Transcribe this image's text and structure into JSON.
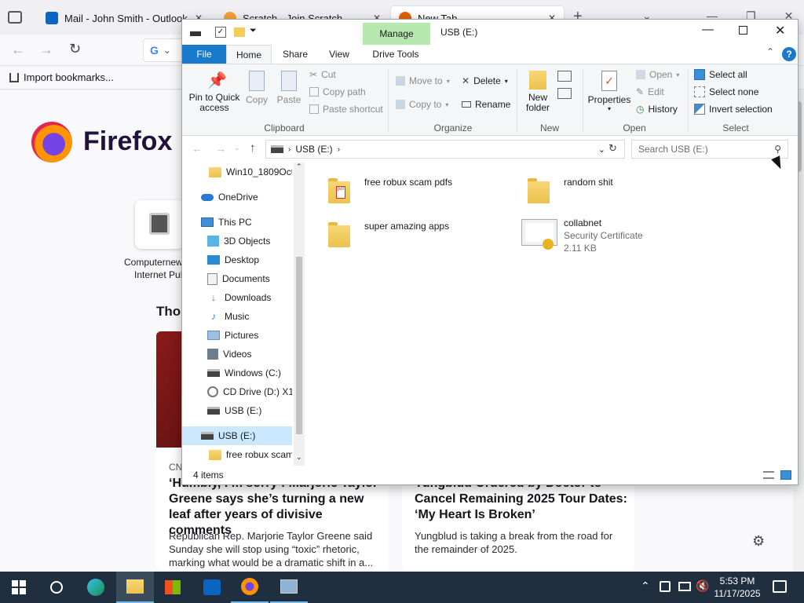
{
  "firefox": {
    "tabs": [
      {
        "title": "Mail - John Smith - Outlook"
      },
      {
        "title": "Scratch - Join Scratch"
      },
      {
        "title": "New Tab"
      }
    ],
    "bookmarks_import": "Import bookmarks...",
    "brand": "Firefox",
    "shortcut_label_1": "Computernew",
    "shortcut_label_2": "Internet Pul",
    "section_heading": "Thou",
    "story_left": {
      "source": "CN",
      "title": "‘Humbly, I’m sorry’: Marjorie Taylor Greene says she’s turning a new leaf after years of divisive comments",
      "excerpt": "Republican Rep. Marjorie Taylor Greene said Sunday she will stop using “toxic” rhetoric, marking what would be a dramatic shift in a..."
    },
    "story_right": {
      "title": "Yungblud Ordered by Doctor to Cancel Remaining 2025 Tour Dates: ‘My Heart Is Broken’",
      "excerpt": "Yungblud is taking a break from the road for the remainder of 2025."
    }
  },
  "explorer": {
    "title": "USB (E:)",
    "manage_tab": "Manage",
    "tabs": [
      "File",
      "Home",
      "Share",
      "View",
      "Drive Tools"
    ],
    "ribbon": {
      "clipboard": {
        "pin": "Pin to Quick access",
        "copy": "Copy",
        "paste": "Paste",
        "cut": "Cut",
        "copy_path": "Copy path",
        "paste_shortcut": "Paste shortcut",
        "label": "Clipboard"
      },
      "organize": {
        "move_to": "Move to",
        "copy_to": "Copy to",
        "delete": "Delete",
        "rename": "Rename",
        "label": "Organize"
      },
      "new": {
        "new_folder_1": "New",
        "new_folder_2": "folder",
        "label": "New"
      },
      "open": {
        "properties": "Properties",
        "open": "Open",
        "edit": "Edit",
        "history": "History",
        "label": "Open"
      },
      "select": {
        "select_all": "Select all",
        "select_none": "Select none",
        "invert": "Invert selection",
        "label": "Select"
      }
    },
    "address": {
      "path": "USB (E:)",
      "search_placeholder": "Search USB (E:)"
    },
    "nav": [
      {
        "label": "Win10_1809Oct_"
      },
      {
        "label": "OneDrive"
      },
      {
        "label": "This PC"
      },
      {
        "label": "3D Objects"
      },
      {
        "label": "Desktop"
      },
      {
        "label": "Documents"
      },
      {
        "label": "Downloads"
      },
      {
        "label": "Music"
      },
      {
        "label": "Pictures"
      },
      {
        "label": "Videos"
      },
      {
        "label": "Windows (C:)"
      },
      {
        "label": "CD Drive (D:) X1("
      },
      {
        "label": "USB (E:)"
      },
      {
        "label": "USB (E:)"
      },
      {
        "label": "free robux scam"
      }
    ],
    "files": [
      {
        "name": "free robux scam pdfs"
      },
      {
        "name": "random shit"
      },
      {
        "name": "super amazing apps"
      },
      {
        "name": "collabnet",
        "type": "Security Certificate",
        "size": "2.11 KB"
      }
    ],
    "status": "4 items"
  },
  "taskbar": {
    "time": "5:53 PM",
    "date": "11/17/2025"
  },
  "colors": {
    "accent": "#0063b1",
    "manage_tab": "#b7e8b0",
    "taskbar": "#1f2f3f"
  }
}
